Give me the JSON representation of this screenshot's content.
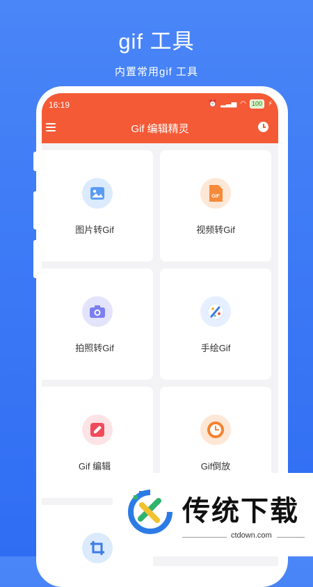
{
  "promo": {
    "title": "gif 工具",
    "subtitle": "内置常用gif 工具"
  },
  "status_bar": {
    "time": "16:19",
    "battery": "100"
  },
  "app_bar": {
    "title": "Gif 编辑精灵"
  },
  "tools": [
    {
      "label": "图片转Gif",
      "icon": "image-icon",
      "color": "#dbeafd"
    },
    {
      "label": "视频转Gif",
      "icon": "gif-file-icon",
      "color": "#fde7d6"
    },
    {
      "label": "拍照转Gif",
      "icon": "camera-icon",
      "color": "#e3e3fb"
    },
    {
      "label": "手绘Gif",
      "icon": "paint-brush-icon",
      "color": "#e5efff"
    },
    {
      "label": "Gif 编辑",
      "icon": "edit-icon",
      "color": "#fde3e6"
    },
    {
      "label": "Gif倒放",
      "icon": "clock-icon",
      "color": "#fde7d6"
    }
  ],
  "watermark": {
    "name": "传统下载",
    "url": "ctdown.com"
  }
}
